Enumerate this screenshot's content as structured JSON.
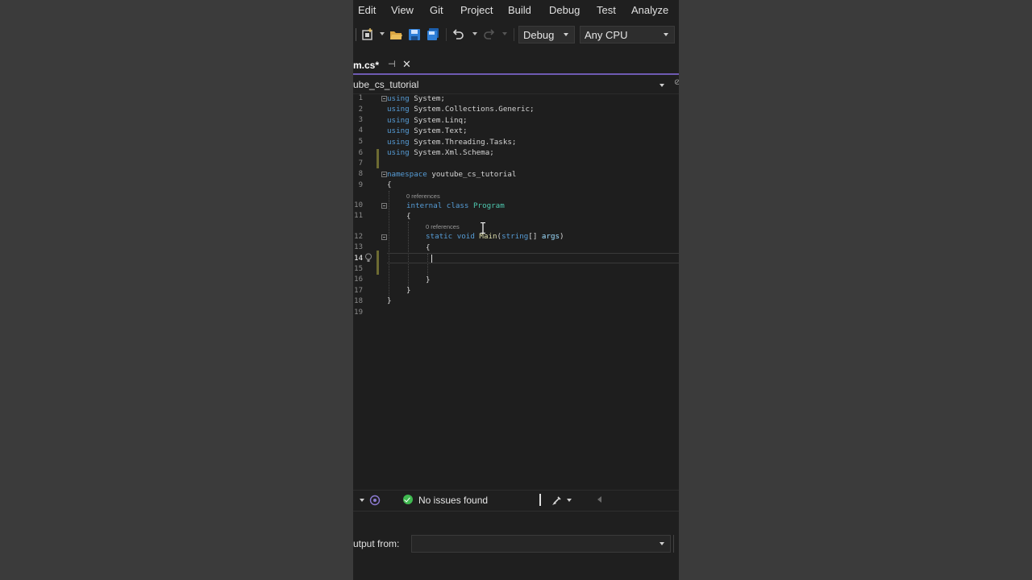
{
  "menu": {
    "items": [
      "Edit",
      "View",
      "Git",
      "Project",
      "Build",
      "Debug",
      "Test",
      "Analyze"
    ]
  },
  "toolbar": {
    "configuration": "Debug",
    "platform": "Any CPU",
    "icons": [
      "new-item-icon",
      "open-folder-icon",
      "save-icon",
      "save-all-icon",
      "undo-icon",
      "redo-icon"
    ]
  },
  "tab": {
    "title": "m.cs*",
    "pin_glyph": "⊣",
    "close_glyph": "✕"
  },
  "navbar": {
    "project": "ube_cs_tutorial"
  },
  "editor": {
    "line_numbers": [
      "1",
      "2",
      "3",
      "4",
      "5",
      "6",
      "7",
      "8",
      "9",
      "10",
      "11",
      "12",
      "13",
      "14",
      "15",
      "16",
      "17",
      "18",
      "19"
    ],
    "active_line": "14",
    "codelens": {
      "class_refs": "0 references",
      "method_refs": "0 references"
    },
    "lines": {
      "l1": {
        "kw": "using",
        "rest": " System;"
      },
      "l2": {
        "kw": "using",
        "rest": " System.Collections.Generic;"
      },
      "l3": {
        "kw": "using",
        "rest": " System.Linq;"
      },
      "l4": {
        "kw": "using",
        "rest": " System.Text;"
      },
      "l5": {
        "kw": "using",
        "rest": " System.Threading.Tasks;"
      },
      "l6": {
        "kw": "using",
        "rest": " System.Xml.Schema;"
      },
      "l8": {
        "kw": "namespace",
        "name": " youtube_cs_tutorial"
      },
      "l9": "{",
      "l10": {
        "kw1": "internal",
        "kw2": " class",
        "type": " Program"
      },
      "l11": "{",
      "l12": {
        "kw1": "static",
        "kw2": " void",
        "method": " Main",
        "open": "(",
        "ptype": "string",
        "arr": "[] ",
        "param": "args",
        "close": ")"
      },
      "l13": "{",
      "l16": "}",
      "l17": "}",
      "l18": "}"
    }
  },
  "status": {
    "issues": "No issues found"
  },
  "output": {
    "label": "utput from:",
    "source": ""
  },
  "colors": {
    "keyword": "#569cd6",
    "type": "#4ec9b0",
    "method": "#dcdcaa",
    "parameter": "#9cdcfe",
    "accent": "#6f5bb3",
    "success": "#3fb950"
  }
}
